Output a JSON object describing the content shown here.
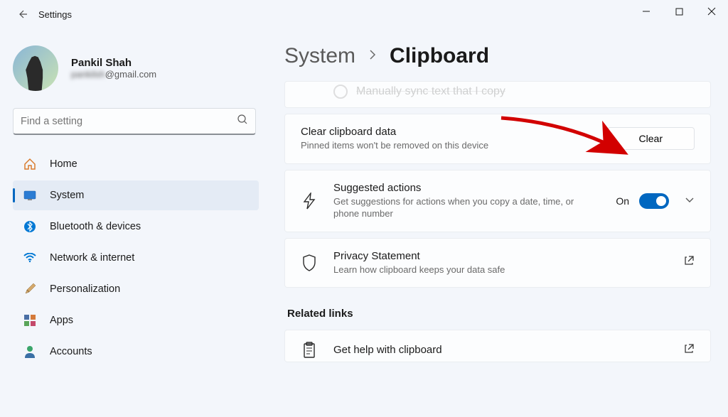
{
  "app": {
    "title": "Settings"
  },
  "profile": {
    "name": "Pankil Shah",
    "email_hidden_prefix": "pankilsh",
    "email_suffix": "@gmail.com"
  },
  "search": {
    "placeholder": "Find a setting"
  },
  "nav": [
    {
      "label": "Home",
      "icon": "home"
    },
    {
      "label": "System",
      "icon": "system",
      "active": true
    },
    {
      "label": "Bluetooth & devices",
      "icon": "bluetooth"
    },
    {
      "label": "Network & internet",
      "icon": "wifi"
    },
    {
      "label": "Personalization",
      "icon": "brush"
    },
    {
      "label": "Apps",
      "icon": "apps"
    },
    {
      "label": "Accounts",
      "icon": "account"
    }
  ],
  "breadcrumb": {
    "parent": "System",
    "current": "Clipboard"
  },
  "cutoff_row": {
    "text": "Manually sync text that I copy"
  },
  "cards": {
    "clear": {
      "title": "Clear clipboard data",
      "subtitle": "Pinned items won't be removed on this device",
      "button": "Clear"
    },
    "suggested": {
      "title": "Suggested actions",
      "subtitle": "Get suggestions for actions when you copy a date, time, or phone number",
      "toggle_state": "On"
    },
    "privacy": {
      "title": "Privacy Statement",
      "subtitle": "Learn how clipboard keeps your data safe"
    }
  },
  "related": {
    "heading": "Related links",
    "help": {
      "title": "Get help with clipboard"
    }
  }
}
